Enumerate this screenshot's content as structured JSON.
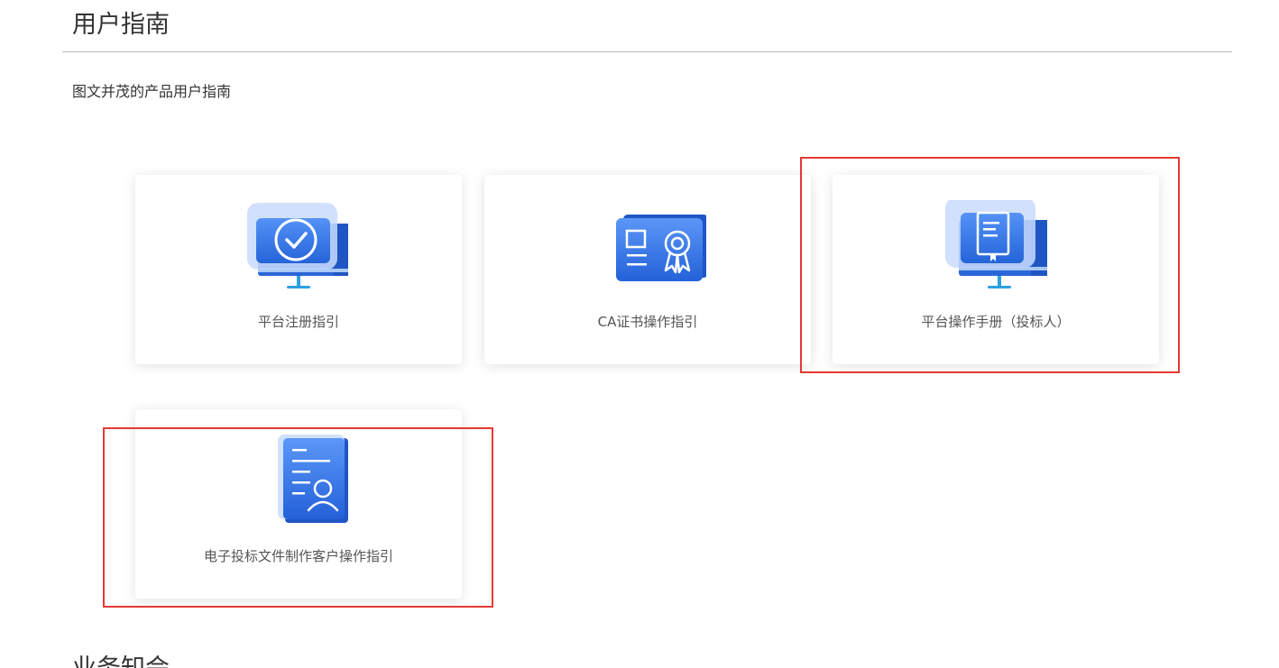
{
  "header": {
    "title": "用户指南",
    "subtitle": "图文并茂的产品用户指南"
  },
  "cards": [
    {
      "label": "平台注册指引",
      "icon": "monitor-check-icon"
    },
    {
      "label": "CA证书操作指引",
      "icon": "certificate-icon"
    },
    {
      "label": "平台操作手册（投标人）",
      "icon": "monitor-book-icon"
    },
    {
      "label": "电子投标文件制作客户操作指引",
      "icon": "document-user-icon"
    }
  ],
  "next_section": {
    "title": "业务知会"
  },
  "colors": {
    "accent_blue": "#2f6fe0",
    "light_blue": "#c9dafb",
    "highlight_red": "#e53935"
  }
}
